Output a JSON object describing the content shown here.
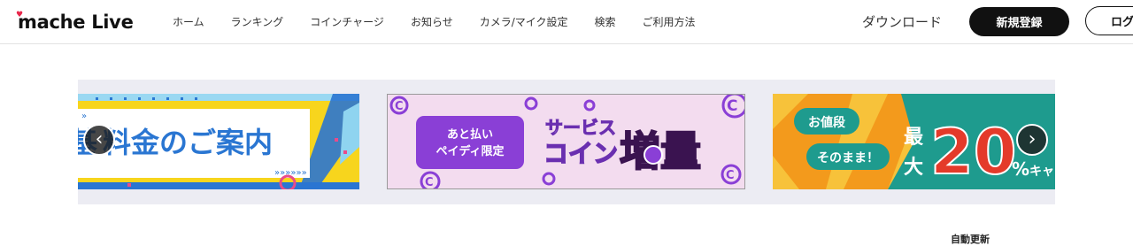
{
  "brand": {
    "logo_text": "mache Live",
    "heart_color": "#e8264a"
  },
  "nav": {
    "items": [
      {
        "label": "ホーム"
      },
      {
        "label": "ランキング"
      },
      {
        "label": "コインチャージ"
      },
      {
        "label": "お知らせ"
      },
      {
        "label": "カメラ/マイク設定"
      },
      {
        "label": "検索"
      },
      {
        "label": "ご利用方法"
      }
    ]
  },
  "header_actions": {
    "download_label": "ダウンロード",
    "register_label": "新規登録",
    "login_label": "ログ"
  },
  "carousel": {
    "prev_icon": "chevron-left-icon",
    "next_icon": "chevron-right-icon",
    "banners": [
      {
        "text": "料金のご案内",
        "partial_char": "基"
      },
      {
        "badge_text": "あと払い\nペイディ限定",
        "title_top": "サービス",
        "title_main": "コイン",
        "title_big": "増量"
      },
      {
        "badge_top": "お値段",
        "badge_bottom": "そのまま！",
        "title_top": "最",
        "title_bottom": "大",
        "percent": "20",
        "percent_sign": "%",
        "suffix": "キャ"
      }
    ]
  },
  "status": {
    "auto_update_label": "自動更新"
  },
  "colors": {
    "accent_purple": "#8a3fd6",
    "banner1_yellow": "#f7d51d",
    "banner1_blue": "#2a76d2",
    "banner3_orange": "#f39a1c",
    "banner3_teal": "#1e9b8e",
    "banner3_red": "#e43a2a"
  }
}
